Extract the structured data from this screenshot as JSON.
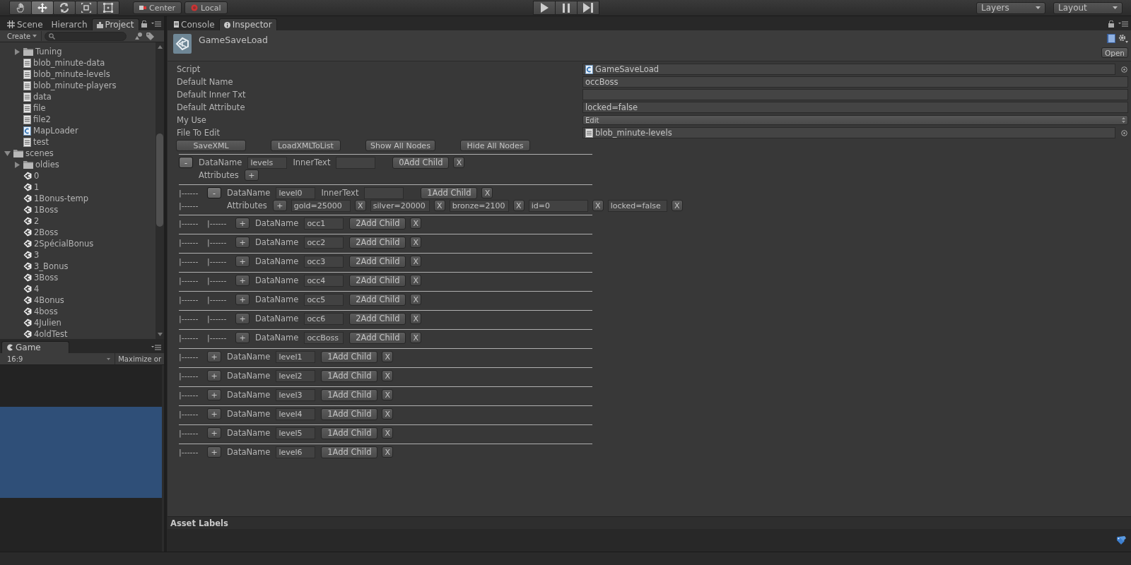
{
  "toolbar": {
    "tools": [
      {
        "kind": "hand",
        "selected": false
      },
      {
        "kind": "move",
        "selected": true
      },
      {
        "kind": "rotate",
        "selected": false
      },
      {
        "kind": "scale",
        "selected": false
      },
      {
        "kind": "rect",
        "selected": false
      }
    ],
    "pivot": [
      {
        "kind": "center",
        "label": "Center"
      },
      {
        "kind": "local",
        "label": "Local"
      }
    ],
    "dropdowns": [
      "Layers",
      "Layout"
    ]
  },
  "left_tabs": [
    {
      "kind": "scene",
      "label": "Scene",
      "selected": false
    },
    {
      "kind": "plain",
      "label": "Hierarch",
      "selected": false
    },
    {
      "kind": "project",
      "label": "Project",
      "selected": true
    }
  ],
  "project": {
    "create": "Create",
    "tree": [
      {
        "children": [
          {
            "kind": "folder",
            "label": "Tuning",
            "expanded": false
          },
          {
            "kind": "text",
            "label": "blob_minute-data"
          },
          {
            "kind": "text",
            "label": "blob_minute-levels"
          },
          {
            "kind": "text",
            "label": "blob_minute-players"
          },
          {
            "kind": "text",
            "label": "data"
          },
          {
            "kind": "text",
            "label": "file"
          },
          {
            "kind": "text",
            "label": "file2"
          },
          {
            "kind": "script",
            "label": "MapLoader"
          },
          {
            "kind": "text",
            "label": "test"
          }
        ]
      },
      {
        "kind": "folder",
        "label": "scenes",
        "expanded": true,
        "children": [
          {
            "kind": "folder",
            "label": "oldies",
            "expanded": false
          },
          {
            "kind": "scene",
            "label": "0"
          },
          {
            "kind": "scene",
            "label": "1"
          },
          {
            "kind": "scene",
            "label": "1Bonus-temp"
          },
          {
            "kind": "scene",
            "label": "1Boss"
          },
          {
            "kind": "scene",
            "label": "2"
          },
          {
            "kind": "scene",
            "label": "2Boss"
          },
          {
            "kind": "scene",
            "label": "2SpécialBonus"
          },
          {
            "kind": "scene",
            "label": "3"
          },
          {
            "kind": "scene",
            "label": "3_Bonus"
          },
          {
            "kind": "scene",
            "label": "3Boss"
          },
          {
            "kind": "scene",
            "label": "4"
          },
          {
            "kind": "scene",
            "label": "4Bonus"
          },
          {
            "kind": "scene",
            "label": "4boss"
          },
          {
            "kind": "scene",
            "label": "4Julien"
          },
          {
            "kind": "scene",
            "label": "4oldTest"
          }
        ]
      }
    ]
  },
  "game": {
    "tab": "Game",
    "aspect": "16:9",
    "maximize": "Maximize or"
  },
  "right_tabs": [
    {
      "kind": "console",
      "label": "Console",
      "selected": false
    },
    {
      "kind": "info",
      "label": "Inspector",
      "selected": true
    }
  ],
  "inspector": {
    "title": "GameSaveLoad",
    "open": "Open",
    "properties": [
      {
        "kind": "script",
        "label": "Script",
        "value": "GameSaveLoad"
      },
      {
        "kind": "text",
        "label": "Default Name",
        "value": "occBoss"
      },
      {
        "kind": "text",
        "label": "Default Inner Txt"
      },
      {
        "kind": "text",
        "label": "Default Attribute",
        "value": "locked=false"
      },
      {
        "kind": "enum",
        "label": "My Use",
        "value": "Edit"
      },
      {
        "kind": "asset",
        "label": "File To Edit",
        "value": "blob_minute-levels"
      }
    ],
    "buttons": [
      "SaveXML",
      "LoadXMLToList",
      "Show All Nodes",
      "Hide All Nodes"
    ],
    "nodes": [
      {
        "toggle": "-",
        "expanded": true,
        "label": "DataName",
        "value": "levels",
        "inner": {
          "label": "InnerText"
        },
        "add": "0Add Child",
        "remove": "X",
        "attributes": {
          "label": "Attributes",
          "add": "+"
        },
        "children": [
          {
            "prefixes": [
              "|------"
            ],
            "toggle": "-",
            "expanded": true,
            "label": "DataName",
            "value": "level0",
            "inner": {
              "label": "InnerText"
            },
            "add": "1Add Child",
            "remove": "X",
            "attributes": {
              "prefixes": [
                "|------"
              ],
              "label": "Attributes",
              "add": "+",
              "items": [
                {
                  "value": "gold=25000",
                  "remove": "X"
                },
                {
                  "value": "silver=20000",
                  "remove": "X"
                },
                {
                  "value": "bronze=2100",
                  "remove": "X"
                },
                {
                  "value": "id=0",
                  "remove": "X"
                },
                {
                  "value": "locked=false",
                  "remove": "X"
                }
              ]
            },
            "children": [
              {
                "prefixes": [
                  "|------",
                  "|------"
                ],
                "toggle": "+",
                "expanded": false,
                "label": "DataName",
                "value": "occ1",
                "add": "2Add Child",
                "remove": "X"
              },
              {
                "prefixes": [
                  "|------",
                  "|------"
                ],
                "toggle": "+",
                "expanded": false,
                "label": "DataName",
                "value": "occ2",
                "add": "2Add Child",
                "remove": "X"
              },
              {
                "prefixes": [
                  "|------",
                  "|------"
                ],
                "toggle": "+",
                "expanded": false,
                "label": "DataName",
                "value": "occ3",
                "add": "2Add Child",
                "remove": "X"
              },
              {
                "prefixes": [
                  "|------",
                  "|------"
                ],
                "toggle": "+",
                "expanded": false,
                "label": "DataName",
                "value": "occ4",
                "add": "2Add Child",
                "remove": "X"
              },
              {
                "prefixes": [
                  "|------",
                  "|------"
                ],
                "toggle": "+",
                "expanded": false,
                "label": "DataName",
                "value": "occ5",
                "add": "2Add Child",
                "remove": "X"
              },
              {
                "prefixes": [
                  "|------",
                  "|------"
                ],
                "toggle": "+",
                "expanded": false,
                "label": "DataName",
                "value": "occ6",
                "add": "2Add Child",
                "remove": "X"
              },
              {
                "prefixes": [
                  "|------",
                  "|------"
                ],
                "toggle": "+",
                "expanded": false,
                "label": "DataName",
                "value": "occBoss",
                "add": "2Add Child",
                "remove": "X"
              }
            ]
          },
          {
            "prefixes": [
              "|------"
            ],
            "toggle": "+",
            "expanded": false,
            "label": "DataName",
            "value": "level1",
            "add": "1Add Child",
            "remove": "X"
          },
          {
            "prefixes": [
              "|------"
            ],
            "toggle": "+",
            "expanded": false,
            "label": "DataName",
            "value": "level2",
            "add": "1Add Child",
            "remove": "X"
          },
          {
            "prefixes": [
              "|------"
            ],
            "toggle": "+",
            "expanded": false,
            "label": "DataName",
            "value": "level3",
            "add": "1Add Child",
            "remove": "X"
          },
          {
            "prefixes": [
              "|------"
            ],
            "toggle": "+",
            "expanded": false,
            "label": "DataName",
            "value": "level4",
            "add": "1Add Child",
            "remove": "X"
          },
          {
            "prefixes": [
              "|------"
            ],
            "toggle": "+",
            "expanded": false,
            "label": "DataName",
            "value": "level5",
            "add": "1Add Child",
            "remove": "X"
          },
          {
            "prefixes": [
              "|------"
            ],
            "toggle": "+",
            "expanded": false,
            "label": "DataName",
            "value": "level6",
            "add": "1Add Child",
            "remove": "X"
          }
        ]
      }
    ]
  },
  "asset_labels": "Asset Labels"
}
